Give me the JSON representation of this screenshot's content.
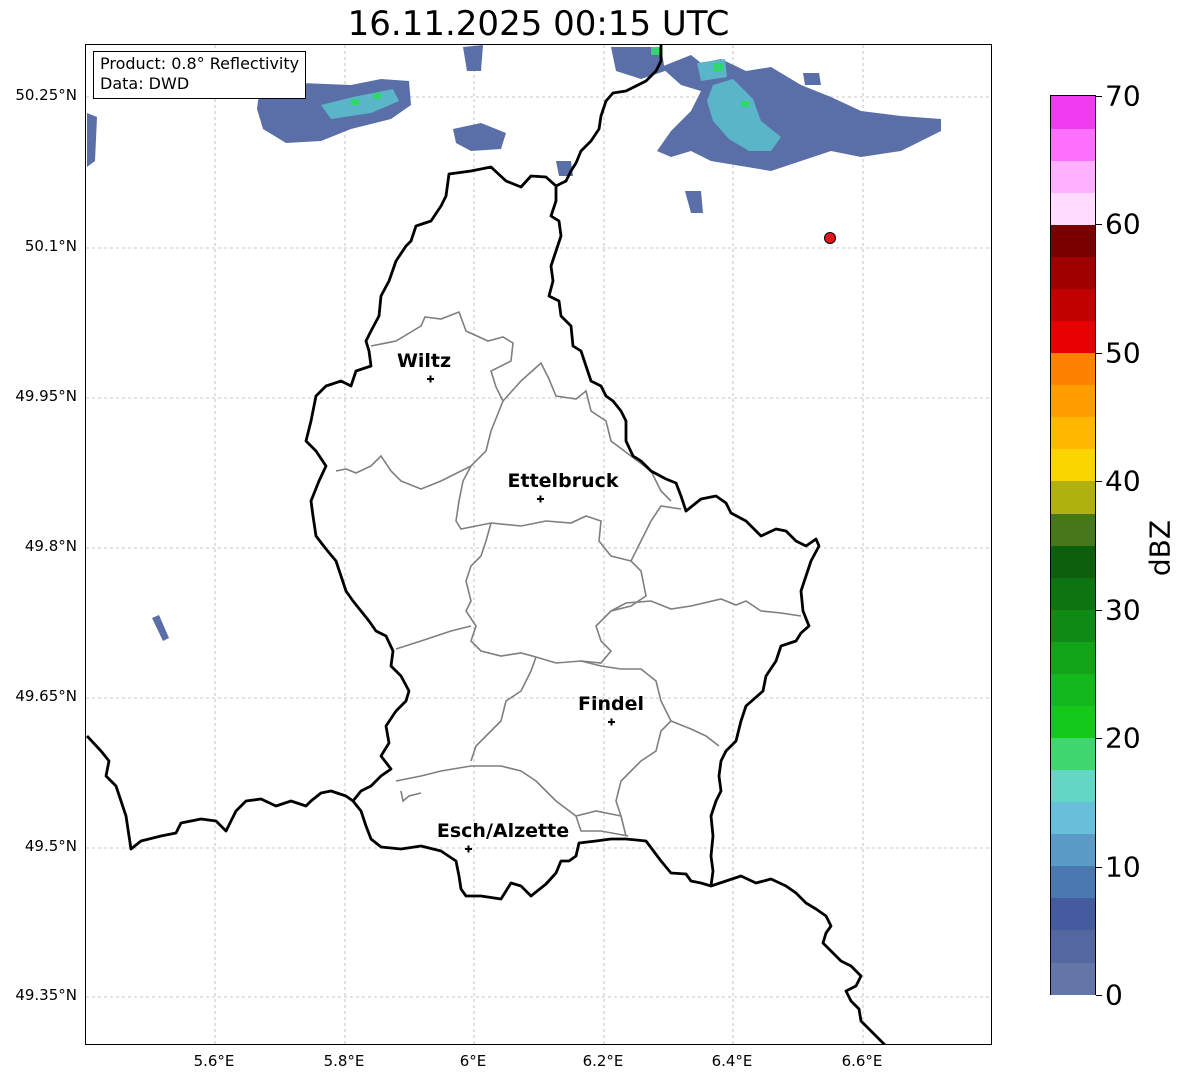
{
  "map": {
    "title": "16.11.2025 00:15 UTC",
    "info_lines": [
      "Product: 0.8° Reflectivity",
      "Data: DWD"
    ],
    "lat_ticks": [
      "50.25°N",
      "50.1°N",
      "49.95°N",
      "49.8°N",
      "49.65°N",
      "49.5°N",
      "49.35°N"
    ],
    "lon_ticks": [
      "5.6°E",
      "5.8°E",
      "6°E",
      "6.2°E",
      "6.4°E",
      "6.6°E"
    ],
    "cities": [
      {
        "name": "Wiltz"
      },
      {
        "name": "Ettelbruck"
      },
      {
        "name": "Findel"
      },
      {
        "name": "Esch/Alzette"
      }
    ],
    "marker": {
      "description": "red point",
      "color": "#e8141a"
    }
  },
  "colorbar": {
    "label": "dBZ",
    "range": [
      0,
      70
    ],
    "ticks": [
      "0",
      "10",
      "20",
      "30",
      "40",
      "50",
      "60",
      "70"
    ],
    "colors": [
      "#6475a8",
      "#5467a0",
      "#445c9f",
      "#4a78b0",
      "#5a9bc7",
      "#67bfd9",
      "#63d6c6",
      "#3dd66f",
      "#15c91b",
      "#12b81c",
      "#11a318",
      "#0f8a14",
      "#0e7412",
      "#0b5f0d",
      "#46771a",
      "#b0b00e",
      "#fbd500",
      "#ffb700",
      "#ff9c00",
      "#ff8100",
      "#e60000",
      "#c20000",
      "#a00000",
      "#780000",
      "#ffdcff",
      "#ffb1ff",
      "#ff70ff",
      "#ef3bef"
    ]
  }
}
